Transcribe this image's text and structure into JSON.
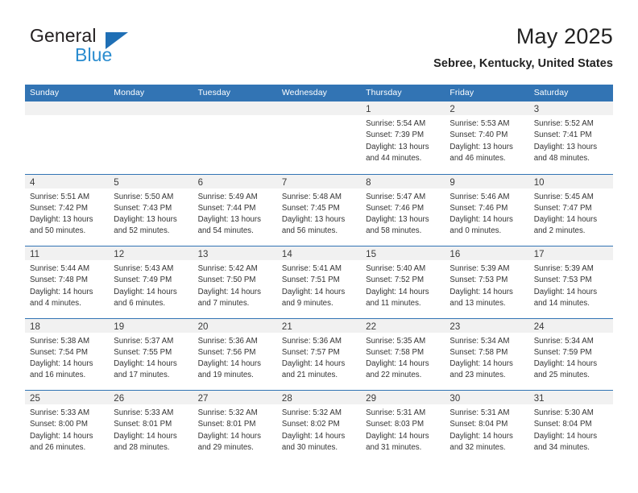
{
  "brand": {
    "name_part1": "General",
    "name_part2": "Blue",
    "logo_icon": "blue-triangle-icon"
  },
  "header": {
    "title": "May 2025",
    "subtitle": "Sebree, Kentucky, United States"
  },
  "colors": {
    "header_blue": "#3274b4",
    "brand_dark_blue": "#1f6fb5",
    "brand_light_blue": "#2a8ccf",
    "day_band_gray": "#f1f1f1",
    "text": "#333333"
  },
  "weekdays": [
    "Sunday",
    "Monday",
    "Tuesday",
    "Wednesday",
    "Thursday",
    "Friday",
    "Saturday"
  ],
  "weeks": [
    [
      {
        "day": "",
        "sunrise": "",
        "sunset": "",
        "daylight_1": "",
        "daylight_2": ""
      },
      {
        "day": "",
        "sunrise": "",
        "sunset": "",
        "daylight_1": "",
        "daylight_2": ""
      },
      {
        "day": "",
        "sunrise": "",
        "sunset": "",
        "daylight_1": "",
        "daylight_2": ""
      },
      {
        "day": "",
        "sunrise": "",
        "sunset": "",
        "daylight_1": "",
        "daylight_2": ""
      },
      {
        "day": "1",
        "sunrise": "Sunrise: 5:54 AM",
        "sunset": "Sunset: 7:39 PM",
        "daylight_1": "Daylight: 13 hours",
        "daylight_2": "and 44 minutes."
      },
      {
        "day": "2",
        "sunrise": "Sunrise: 5:53 AM",
        "sunset": "Sunset: 7:40 PM",
        "daylight_1": "Daylight: 13 hours",
        "daylight_2": "and 46 minutes."
      },
      {
        "day": "3",
        "sunrise": "Sunrise: 5:52 AM",
        "sunset": "Sunset: 7:41 PM",
        "daylight_1": "Daylight: 13 hours",
        "daylight_2": "and 48 minutes."
      }
    ],
    [
      {
        "day": "4",
        "sunrise": "Sunrise: 5:51 AM",
        "sunset": "Sunset: 7:42 PM",
        "daylight_1": "Daylight: 13 hours",
        "daylight_2": "and 50 minutes."
      },
      {
        "day": "5",
        "sunrise": "Sunrise: 5:50 AM",
        "sunset": "Sunset: 7:43 PM",
        "daylight_1": "Daylight: 13 hours",
        "daylight_2": "and 52 minutes."
      },
      {
        "day": "6",
        "sunrise": "Sunrise: 5:49 AM",
        "sunset": "Sunset: 7:44 PM",
        "daylight_1": "Daylight: 13 hours",
        "daylight_2": "and 54 minutes."
      },
      {
        "day": "7",
        "sunrise": "Sunrise: 5:48 AM",
        "sunset": "Sunset: 7:45 PM",
        "daylight_1": "Daylight: 13 hours",
        "daylight_2": "and 56 minutes."
      },
      {
        "day": "8",
        "sunrise": "Sunrise: 5:47 AM",
        "sunset": "Sunset: 7:46 PM",
        "daylight_1": "Daylight: 13 hours",
        "daylight_2": "and 58 minutes."
      },
      {
        "day": "9",
        "sunrise": "Sunrise: 5:46 AM",
        "sunset": "Sunset: 7:46 PM",
        "daylight_1": "Daylight: 14 hours",
        "daylight_2": "and 0 minutes."
      },
      {
        "day": "10",
        "sunrise": "Sunrise: 5:45 AM",
        "sunset": "Sunset: 7:47 PM",
        "daylight_1": "Daylight: 14 hours",
        "daylight_2": "and 2 minutes."
      }
    ],
    [
      {
        "day": "11",
        "sunrise": "Sunrise: 5:44 AM",
        "sunset": "Sunset: 7:48 PM",
        "daylight_1": "Daylight: 14 hours",
        "daylight_2": "and 4 minutes."
      },
      {
        "day": "12",
        "sunrise": "Sunrise: 5:43 AM",
        "sunset": "Sunset: 7:49 PM",
        "daylight_1": "Daylight: 14 hours",
        "daylight_2": "and 6 minutes."
      },
      {
        "day": "13",
        "sunrise": "Sunrise: 5:42 AM",
        "sunset": "Sunset: 7:50 PM",
        "daylight_1": "Daylight: 14 hours",
        "daylight_2": "and 7 minutes."
      },
      {
        "day": "14",
        "sunrise": "Sunrise: 5:41 AM",
        "sunset": "Sunset: 7:51 PM",
        "daylight_1": "Daylight: 14 hours",
        "daylight_2": "and 9 minutes."
      },
      {
        "day": "15",
        "sunrise": "Sunrise: 5:40 AM",
        "sunset": "Sunset: 7:52 PM",
        "daylight_1": "Daylight: 14 hours",
        "daylight_2": "and 11 minutes."
      },
      {
        "day": "16",
        "sunrise": "Sunrise: 5:39 AM",
        "sunset": "Sunset: 7:53 PM",
        "daylight_1": "Daylight: 14 hours",
        "daylight_2": "and 13 minutes."
      },
      {
        "day": "17",
        "sunrise": "Sunrise: 5:39 AM",
        "sunset": "Sunset: 7:53 PM",
        "daylight_1": "Daylight: 14 hours",
        "daylight_2": "and 14 minutes."
      }
    ],
    [
      {
        "day": "18",
        "sunrise": "Sunrise: 5:38 AM",
        "sunset": "Sunset: 7:54 PM",
        "daylight_1": "Daylight: 14 hours",
        "daylight_2": "and 16 minutes."
      },
      {
        "day": "19",
        "sunrise": "Sunrise: 5:37 AM",
        "sunset": "Sunset: 7:55 PM",
        "daylight_1": "Daylight: 14 hours",
        "daylight_2": "and 17 minutes."
      },
      {
        "day": "20",
        "sunrise": "Sunrise: 5:36 AM",
        "sunset": "Sunset: 7:56 PM",
        "daylight_1": "Daylight: 14 hours",
        "daylight_2": "and 19 minutes."
      },
      {
        "day": "21",
        "sunrise": "Sunrise: 5:36 AM",
        "sunset": "Sunset: 7:57 PM",
        "daylight_1": "Daylight: 14 hours",
        "daylight_2": "and 21 minutes."
      },
      {
        "day": "22",
        "sunrise": "Sunrise: 5:35 AM",
        "sunset": "Sunset: 7:58 PM",
        "daylight_1": "Daylight: 14 hours",
        "daylight_2": "and 22 minutes."
      },
      {
        "day": "23",
        "sunrise": "Sunrise: 5:34 AM",
        "sunset": "Sunset: 7:58 PM",
        "daylight_1": "Daylight: 14 hours",
        "daylight_2": "and 23 minutes."
      },
      {
        "day": "24",
        "sunrise": "Sunrise: 5:34 AM",
        "sunset": "Sunset: 7:59 PM",
        "daylight_1": "Daylight: 14 hours",
        "daylight_2": "and 25 minutes."
      }
    ],
    [
      {
        "day": "25",
        "sunrise": "Sunrise: 5:33 AM",
        "sunset": "Sunset: 8:00 PM",
        "daylight_1": "Daylight: 14 hours",
        "daylight_2": "and 26 minutes."
      },
      {
        "day": "26",
        "sunrise": "Sunrise: 5:33 AM",
        "sunset": "Sunset: 8:01 PM",
        "daylight_1": "Daylight: 14 hours",
        "daylight_2": "and 28 minutes."
      },
      {
        "day": "27",
        "sunrise": "Sunrise: 5:32 AM",
        "sunset": "Sunset: 8:01 PM",
        "daylight_1": "Daylight: 14 hours",
        "daylight_2": "and 29 minutes."
      },
      {
        "day": "28",
        "sunrise": "Sunrise: 5:32 AM",
        "sunset": "Sunset: 8:02 PM",
        "daylight_1": "Daylight: 14 hours",
        "daylight_2": "and 30 minutes."
      },
      {
        "day": "29",
        "sunrise": "Sunrise: 5:31 AM",
        "sunset": "Sunset: 8:03 PM",
        "daylight_1": "Daylight: 14 hours",
        "daylight_2": "and 31 minutes."
      },
      {
        "day": "30",
        "sunrise": "Sunrise: 5:31 AM",
        "sunset": "Sunset: 8:04 PM",
        "daylight_1": "Daylight: 14 hours",
        "daylight_2": "and 32 minutes."
      },
      {
        "day": "31",
        "sunrise": "Sunrise: 5:30 AM",
        "sunset": "Sunset: 8:04 PM",
        "daylight_1": "Daylight: 14 hours",
        "daylight_2": "and 34 minutes."
      }
    ]
  ]
}
